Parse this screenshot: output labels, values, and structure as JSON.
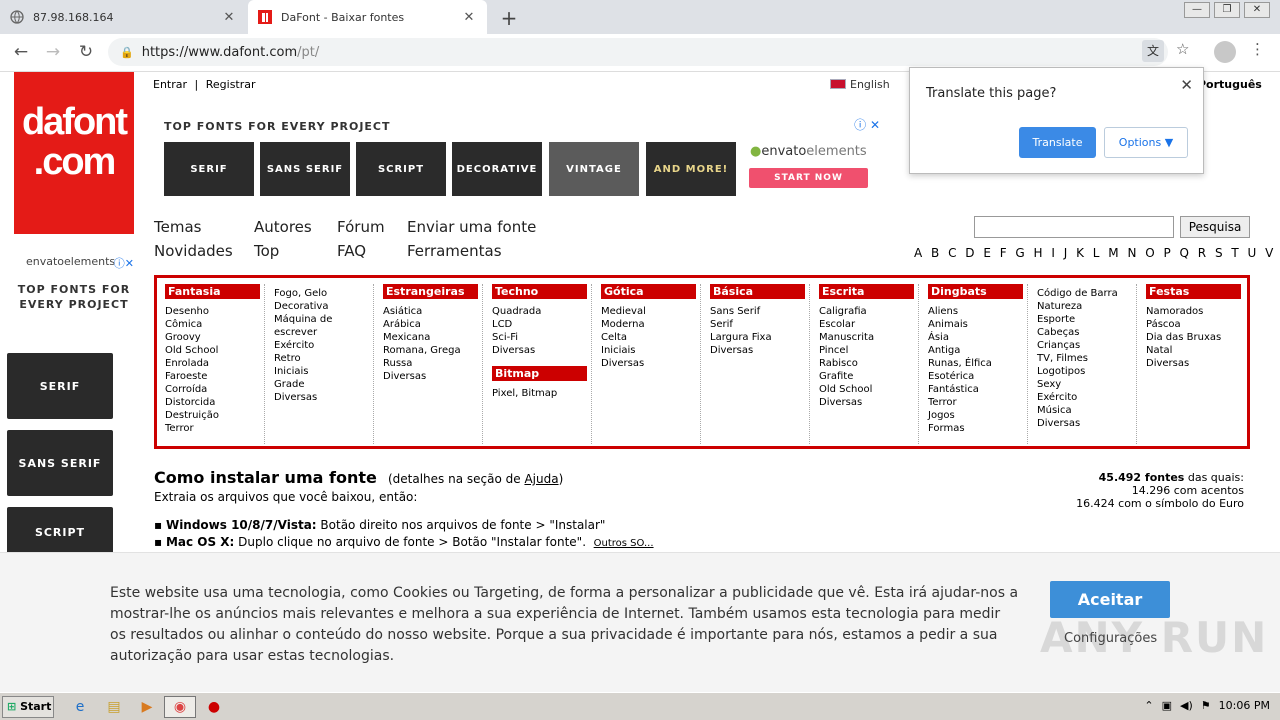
{
  "browser": {
    "tabs": [
      {
        "title": "87.98.168.164"
      },
      {
        "title": "DaFont - Baixar fontes"
      }
    ],
    "url_main": "https://www.dafont.com",
    "url_path": "/pt/",
    "win_controls": [
      "—",
      "❐",
      "✕"
    ]
  },
  "translate_popup": {
    "title": "Translate this page?",
    "translate": "Translate",
    "options": "Options"
  },
  "logo": {
    "line1": "dafont",
    "line2": ".com"
  },
  "topbar": {
    "login": "Entrar",
    "sep": "|",
    "register": "Registrar"
  },
  "languages": {
    "english": "English",
    "portuguese": "Português"
  },
  "ad_banner": {
    "heading": "TOP FONTS FOR EVERY PROJECT",
    "tiles": [
      "SERIF",
      "SANS SERIF",
      "SCRIPT",
      "DECORATIVE",
      "VINTAGE",
      "AND MORE!"
    ],
    "brand": "envato",
    "brand2": "elements",
    "cta": "START NOW"
  },
  "side_ad": {
    "brand": "envatoelements",
    "heading": "TOP FONTS FOR EVERY PROJECT",
    "tiles": [
      "SERIF",
      "SANS SERIF",
      "SCRIPT"
    ]
  },
  "main_nav": [
    {
      "label": "Temas"
    },
    {
      "label": "Autores"
    },
    {
      "label": "Fórum"
    },
    {
      "label": "Enviar uma fonte"
    },
    {
      "label": "Novidades"
    },
    {
      "label": "Top"
    },
    {
      "label": "FAQ"
    },
    {
      "label": "Ferramentas"
    }
  ],
  "search": {
    "button": "Pesquisa",
    "value": ""
  },
  "alphabet": "A B C D E F G H I J K L M N O P Q R S T U V W X Y Z #",
  "categories": [
    {
      "header": "Fantasia",
      "items": [
        "Desenho",
        "Cômica",
        "Groovy",
        "Old School",
        "Enrolada",
        "Faroeste",
        "Corroída",
        "Distorcida",
        "Destruição",
        "Terror"
      ]
    },
    {
      "header": "",
      "items": [
        "Fogo, Gelo",
        "Decorativa",
        "Máquina de",
        "escrever",
        "Exército",
        "Retro",
        "Iniciais",
        "Grade",
        "Diversas"
      ]
    },
    {
      "header": "Estrangeiras",
      "items": [
        "Asiática",
        "Arábica",
        "Mexicana",
        "Romana, Grega",
        "Russa",
        "Diversas"
      ]
    },
    {
      "header": "Techno",
      "items": [
        "Quadrada",
        "LCD",
        "Sci-Fi",
        "Diversas"
      ],
      "header2": "Bitmap",
      "items2": [
        "Pixel, Bitmap"
      ]
    },
    {
      "header": "Gótica",
      "items": [
        "Medieval",
        "Moderna",
        "Celta",
        "Iniciais",
        "Diversas"
      ]
    },
    {
      "header": "Básica",
      "items": [
        "Sans Serif",
        "Serif",
        "Largura Fixa",
        "Diversas"
      ]
    },
    {
      "header": "Escrita",
      "items": [
        "Caligrafia",
        "Escolar",
        "Manuscrita",
        "Pincel",
        "Rabisco",
        "Grafite",
        "Old School",
        "Diversas"
      ]
    },
    {
      "header": "Dingbats",
      "items": [
        "Aliens",
        "Animais",
        "Ásia",
        "Antiga",
        "Runas, Élfica",
        "Esotérica",
        "Fantástica",
        "Terror",
        "Jogos",
        "Formas"
      ]
    },
    {
      "header": "",
      "items": [
        "Código de Barra",
        "Natureza",
        "Esporte",
        "Cabeças",
        "Crianças",
        "TV, Filmes",
        "Logotipos",
        "Sexy",
        "Exército",
        "Música",
        "Diversas"
      ]
    },
    {
      "header": "Festas",
      "items": [
        "Namorados",
        "Páscoa",
        "Dia das Bruxas",
        "Natal",
        "Diversas"
      ]
    }
  ],
  "howto": {
    "title": "Como instalar uma fonte",
    "detail_pre": "(detalhes na seção de ",
    "detail_link": "Ajuda",
    "detail_post": ")",
    "subtitle": "Extraia os arquivos que você baixou, então:",
    "win_label": "Windows 10/8/7/Vista:",
    "win_text": " Botão direito nos arquivos de fonte > \"Instalar\"",
    "mac_label": "Mac OS X:",
    "mac_text": " Duplo clique no arquivo de fonte > Botão \"Instalar fonte\".",
    "other": "Outros SO..."
  },
  "font_stats": {
    "count": "45.492 fontes",
    "count_suffix": " das quais:",
    "accents": "14.296 com acentos",
    "euro": "16.424 com o símbolo do Euro"
  },
  "cookie": {
    "text": "Este website usa uma tecnologia, como Cookies ou Targeting, de forma a personalizar a publicidade que vê. Esta irá ajudar-nos a mostrar-lhe os anúncios mais relevantes e melhora a sua experiência de Internet. Também usamos esta tecnologia para medir os resultados ou alinhar o conteúdo do nosso website. Porque a sua privacidade é importante para nós, estamos a pedir a sua autorização para usar estas tecnologias.",
    "accept": "Aceitar",
    "settings": "Configurações"
  },
  "watermark": "ANY RUN",
  "taskbar": {
    "start": "Start",
    "time": "10:06 PM"
  },
  "colors": {
    "brand_red": "#e41b17",
    "category_red": "#cc0000",
    "accept_blue": "#3d8fd8"
  }
}
